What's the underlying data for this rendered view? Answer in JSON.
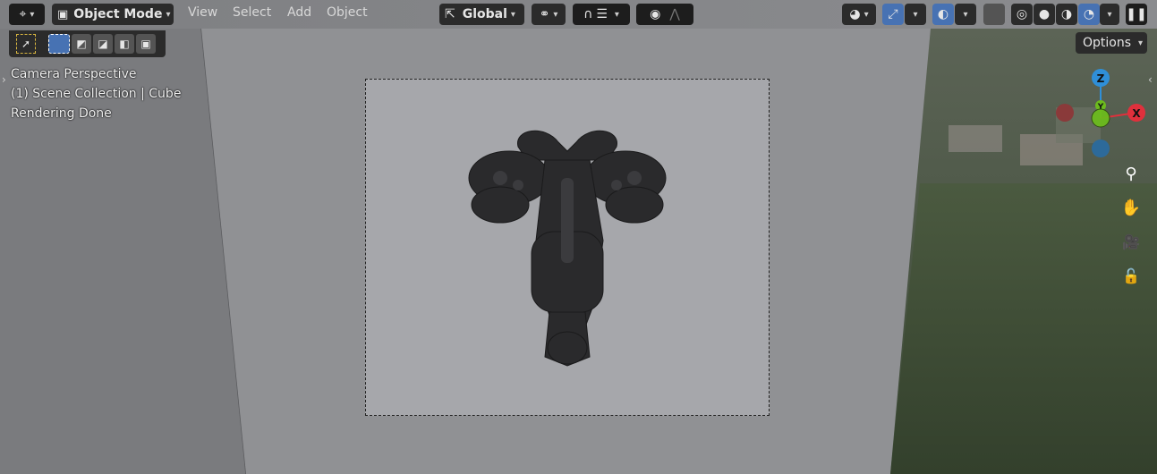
{
  "header": {
    "mode_label": "Object Mode",
    "menus": [
      "View",
      "Select",
      "Add",
      "Object"
    ],
    "orientation_label": "Global"
  },
  "overlay": {
    "line1": "Camera Perspective",
    "line2": "(1) Scene Collection | Cube",
    "line3": "Rendering Done"
  },
  "options_label": "Options",
  "gizmo": {
    "z": "Z",
    "y": "Y",
    "x": "X"
  },
  "colors": {
    "header_bg": "#3d3d3d",
    "active_blue": "#4772b3",
    "axis_x": "#e0303c",
    "axis_y": "#6cbb1d",
    "axis_z": "#2f8fd8",
    "viewport_gray": "#8f9092"
  },
  "icons": [
    "editor-type-icon",
    "object-mode-icon",
    "orientation-icon",
    "pivot-icon",
    "snap-icon",
    "proportional-edit-icon",
    "visibility-icon",
    "gizmo-icon",
    "overlay-icon",
    "xray-icon",
    "wireframe-shading-icon",
    "solid-shading-icon",
    "material-shading-icon",
    "rendered-shading-icon",
    "pause-icon",
    "select-box-icon",
    "zoom-icon",
    "pan-hand-icon",
    "camera-icon",
    "lock-icon"
  ]
}
